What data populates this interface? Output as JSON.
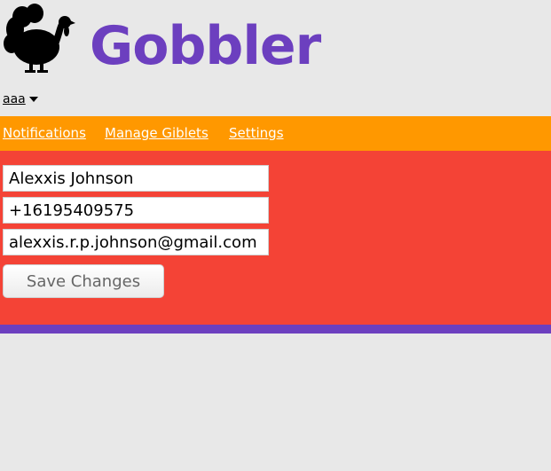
{
  "header": {
    "logo_icon": "turkey-icon",
    "app_title": "Gobbler",
    "brand_color": "#6c3fbf"
  },
  "user_menu": {
    "label": "aaa",
    "icon": "caret-down-icon"
  },
  "nav": {
    "background": "#ff9800",
    "items": [
      {
        "label": "Notifications"
      },
      {
        "label": "Manage Giblets"
      },
      {
        "label": "Settings"
      }
    ]
  },
  "form": {
    "background": "#f44336",
    "name_value": "Alexxis Johnson",
    "phone_value": "+16195409575",
    "email_value": "alexxis.r.p.johnson@gmail.com",
    "save_label": "Save Changes"
  }
}
